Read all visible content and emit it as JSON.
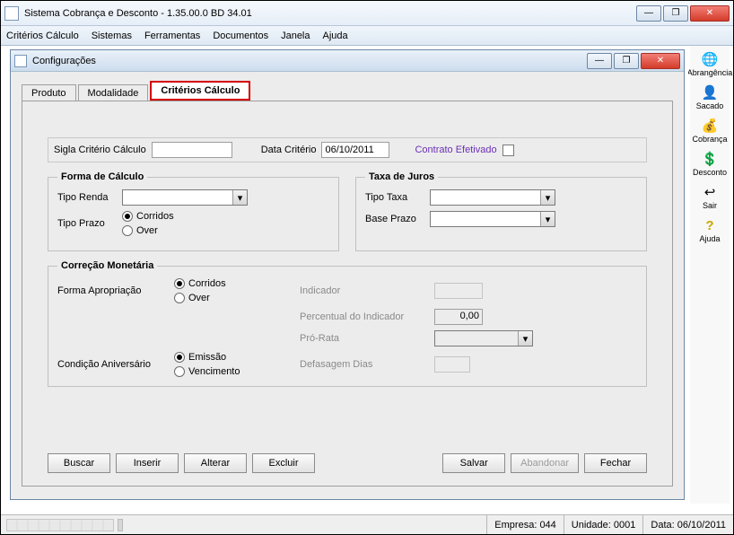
{
  "window": {
    "title": "Sistema Cobrança e Desconto - 1.35.00.0 BD 34.01"
  },
  "menubar": [
    "Critérios Cálculo",
    "Sistemas",
    "Ferramentas",
    "Documentos",
    "Janela",
    "Ajuda"
  ],
  "right_toolbar": [
    {
      "label": "Abrangência",
      "glyph": "🌐"
    },
    {
      "label": "Sacado",
      "glyph": "👤"
    },
    {
      "label": "Cobrança",
      "glyph": "💰"
    },
    {
      "label": "Desconto",
      "glyph": "💲"
    },
    {
      "label": "Sair",
      "glyph": "↩"
    },
    {
      "label": "Ajuda",
      "glyph": "?"
    }
  ],
  "inner_window": {
    "title": "Configurações"
  },
  "tabs": {
    "items": [
      "Produto",
      "Modalidade",
      "Critérios Cálculo"
    ],
    "active_index": 2
  },
  "top_row": {
    "sigla_label": "Sigla Critério Cálculo",
    "sigla_value": "",
    "data_label": "Data Critério",
    "data_value": "06/10/2011",
    "contrato_label": "Contrato Efetivado"
  },
  "forma_calculo": {
    "legend": "Forma de Cálculo",
    "tipo_renda_label": "Tipo Renda",
    "tipo_prazo_label": "Tipo Prazo",
    "opt_corridos": "Corridos",
    "opt_over": "Over"
  },
  "taxa_juros": {
    "legend": "Taxa de Juros",
    "tipo_taxa_label": "Tipo Taxa",
    "base_prazo_label": "Base Prazo"
  },
  "correcao": {
    "legend": "Correção Monetária",
    "forma_aprop_label": "Forma Apropriação",
    "opt_corridos": "Corridos",
    "opt_over": "Over",
    "indicador_label": "Indicador",
    "percentual_label": "Percentual do Indicador",
    "percentual_value": "0,00",
    "prorata_label": "Pró-Rata",
    "cond_aniv_label": "Condição Aniversário",
    "opt_emissao": "Emissão",
    "opt_venc": "Vencimento",
    "defasagem_label": "Defasagem Dias"
  },
  "buttons": {
    "buscar": "Buscar",
    "inserir": "Inserir",
    "alterar": "Alterar",
    "excluir": "Excluir",
    "salvar": "Salvar",
    "abandonar": "Abandonar",
    "fechar": "Fechar"
  },
  "statusbar": {
    "empresa_label": "Empresa:",
    "empresa_value": "044",
    "unidade_label": "Unidade:",
    "unidade_value": "0001",
    "data_label": "Data:",
    "data_value": "06/10/2011"
  }
}
